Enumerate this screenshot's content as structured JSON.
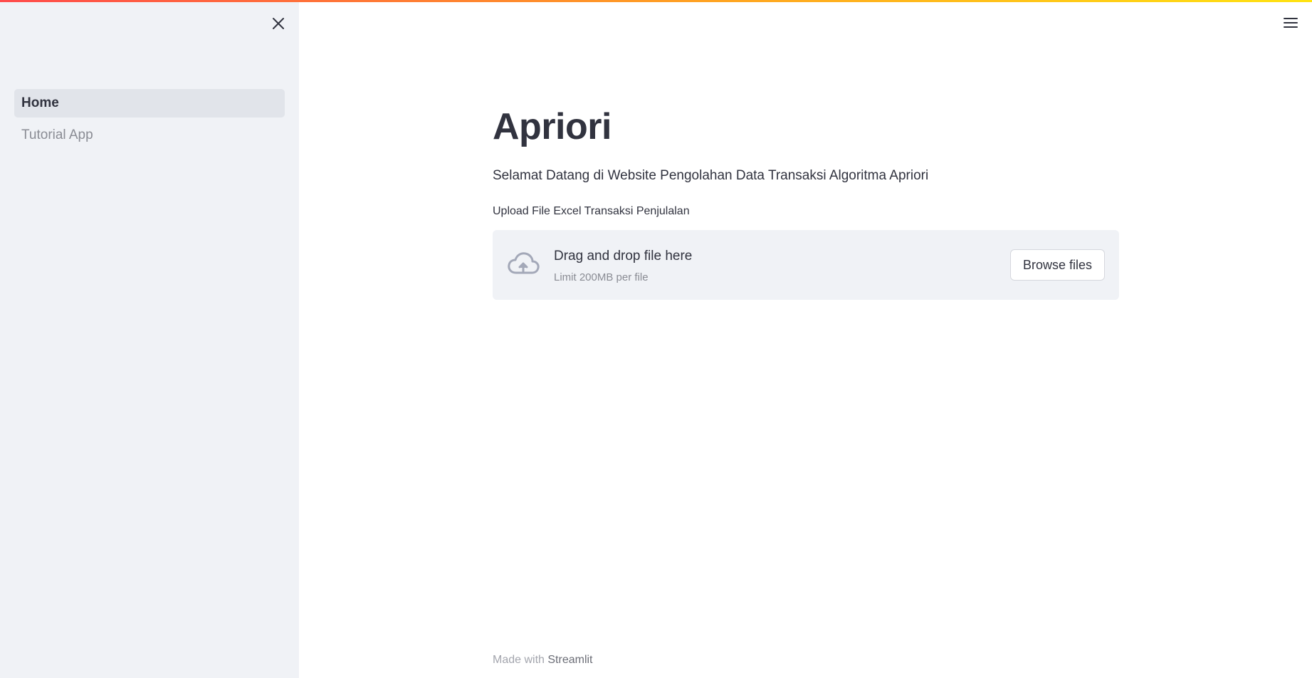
{
  "sidebar": {
    "close_icon": "close-icon",
    "items": [
      {
        "label": "Home",
        "active": true
      },
      {
        "label": "Tutorial App",
        "active": false
      }
    ]
  },
  "header": {
    "menu_icon": "hamburger-menu-icon"
  },
  "main": {
    "title": "Apriori",
    "subtitle": "Selamat Datang di Website Pengolahan Data Transaksi Algoritma Apriori",
    "uploader": {
      "label": "Upload File Excel Transaksi Penjulalan",
      "icon": "cloud-upload-icon",
      "drag_text": "Drag and drop file here",
      "limit_text": "Limit 200MB per file",
      "button_label": "Browse files"
    }
  },
  "footer": {
    "prefix": "Made with",
    "brand": "Streamlit"
  },
  "colors": {
    "primary_gradient_start": "#ff4b4b",
    "primary_gradient_end": "#ffe312",
    "sidebar_bg": "#f0f2f6",
    "text": "#31333f",
    "muted_text": "#8a8c94"
  }
}
